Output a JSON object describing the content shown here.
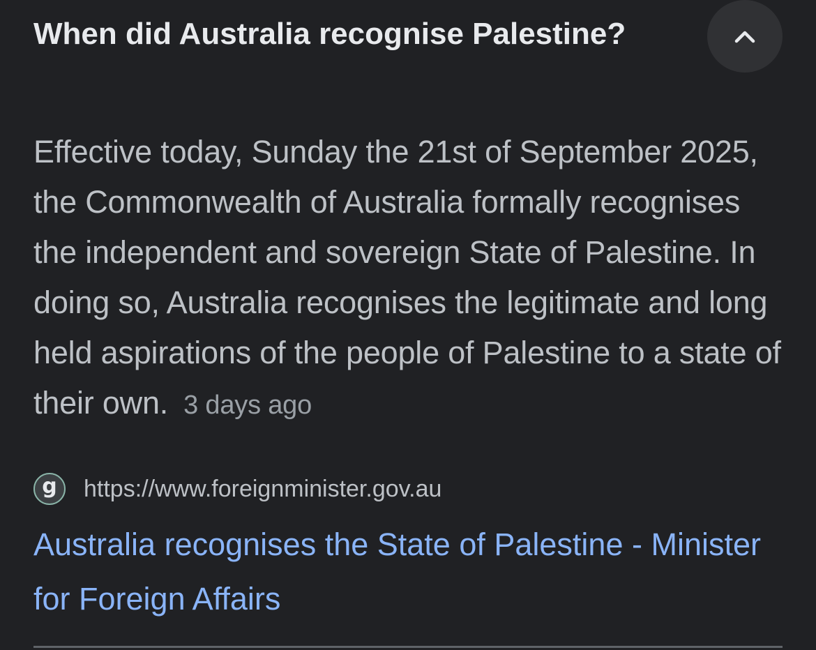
{
  "question": {
    "title": "When did Australia recognise Palestine?",
    "toggle_icon": "chevron-up-icon"
  },
  "answer": {
    "text": "Effective today, Sunday the 21st of September 2025, the Commonwealth of Australia formally recognises the independent and sovereign State of Palestine. In doing so, Australia recognises the legitimate and long held aspirations of the people of Palestine to a state of their own.",
    "date": "3 days ago"
  },
  "source": {
    "favicon_letter": "g",
    "url": "https://www.foreignminister.gov.au",
    "link_title": "Australia recognises the State of Palestine - Minister for Foreign Affairs"
  },
  "colors": {
    "background": "#202124",
    "title": "#e8eaed",
    "body_text": "#bdc1c6",
    "link": "#8ab4f8",
    "button_bg": "#303134"
  }
}
